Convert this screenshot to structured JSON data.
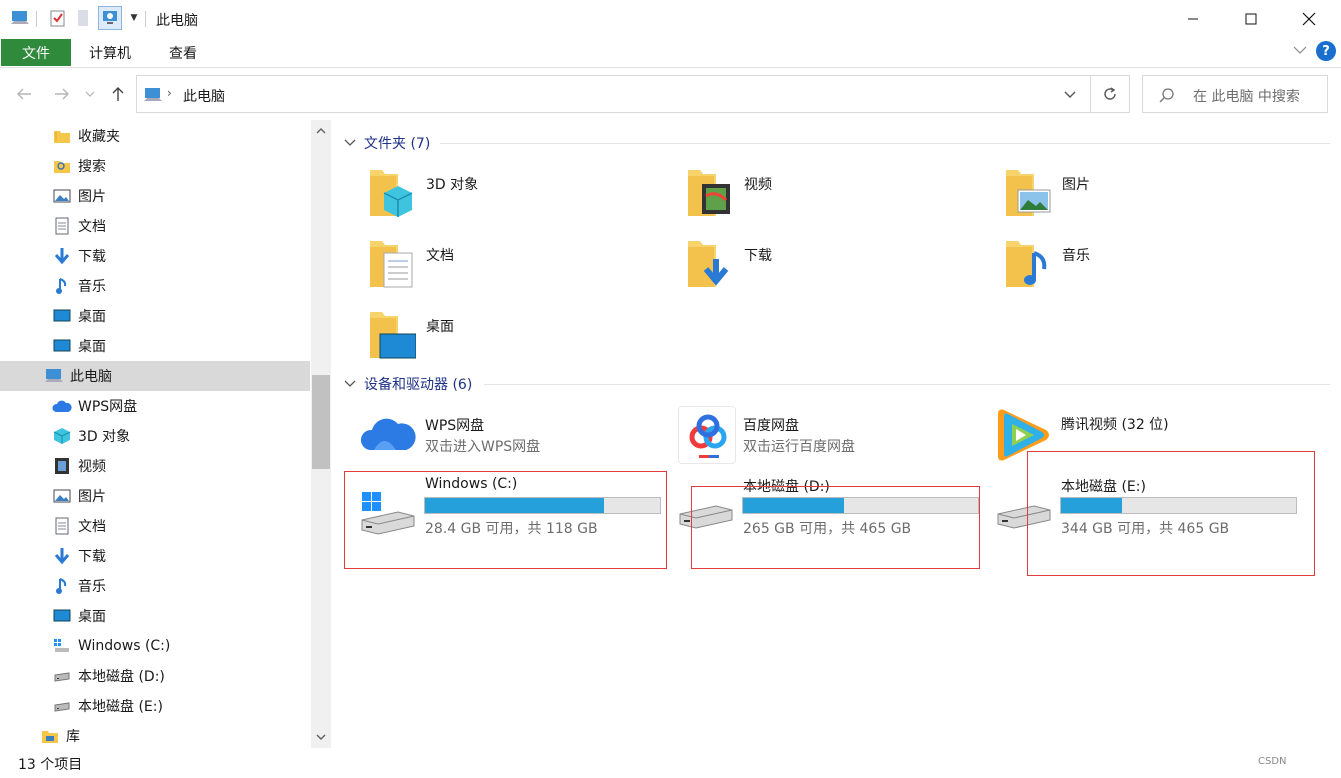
{
  "window": {
    "title": "此电脑"
  },
  "ribbon": {
    "tabs": [
      {
        "label": "文件",
        "active": true
      },
      {
        "label": "计算机",
        "active": false
      },
      {
        "label": "查看",
        "active": false
      }
    ]
  },
  "address": {
    "path": "此电脑",
    "search_placeholder": "在 此电脑 中搜索"
  },
  "sidebar": {
    "items": [
      {
        "label": "收藏夹",
        "icon": "star-folder-icon"
      },
      {
        "label": "搜索",
        "icon": "search-folder-icon"
      },
      {
        "label": "图片",
        "icon": "pictures-icon"
      },
      {
        "label": "文档",
        "icon": "documents-icon"
      },
      {
        "label": "下载",
        "icon": "download-icon"
      },
      {
        "label": "音乐",
        "icon": "music-icon"
      },
      {
        "label": "桌面",
        "icon": "desktop-icon"
      },
      {
        "label": "桌面",
        "icon": "desktop-icon"
      },
      {
        "label": "此电脑",
        "icon": "this-pc-icon",
        "selected": true
      },
      {
        "label": "WPS网盘",
        "icon": "wps-cloud-icon"
      },
      {
        "label": "3D 对象",
        "icon": "3d-objects-icon"
      },
      {
        "label": "视频",
        "icon": "video-icon"
      },
      {
        "label": "图片",
        "icon": "pictures-icon"
      },
      {
        "label": "文档",
        "icon": "documents-icon"
      },
      {
        "label": "下载",
        "icon": "download-icon"
      },
      {
        "label": "音乐",
        "icon": "music-icon"
      },
      {
        "label": "桌面",
        "icon": "desktop-icon"
      },
      {
        "label": "Windows (C:)",
        "icon": "windows-drive-icon"
      },
      {
        "label": "本地磁盘 (D:)",
        "icon": "drive-icon"
      },
      {
        "label": "本地磁盘 (E:)",
        "icon": "drive-icon"
      },
      {
        "label": "库",
        "icon": "library-icon"
      }
    ]
  },
  "folders_group": {
    "header": "文件夹 (7)",
    "items": [
      {
        "label": "3D 对象",
        "icon": "3d-objects-folder-icon"
      },
      {
        "label": "视频",
        "icon": "video-folder-icon"
      },
      {
        "label": "图片",
        "icon": "pictures-folder-icon"
      },
      {
        "label": "文档",
        "icon": "documents-folder-icon"
      },
      {
        "label": "下载",
        "icon": "download-folder-icon"
      },
      {
        "label": "音乐",
        "icon": "music-folder-icon"
      },
      {
        "label": "桌面",
        "icon": "desktop-folder-icon"
      }
    ]
  },
  "devices_group": {
    "header": "设备和驱动器 (6)",
    "apps": [
      {
        "name": "WPS网盘",
        "sub": "双击进入WPS网盘",
        "icon": "wps-cloud-icon"
      },
      {
        "name": "百度网盘",
        "sub": "双击运行百度网盘",
        "icon": "baidu-netdisk-icon"
      },
      {
        "name": "腾讯视频 (32 位)",
        "sub": "",
        "icon": "tencent-video-icon"
      }
    ],
    "drives": [
      {
        "name": "Windows (C:)",
        "sub": "28.4 GB 可用，共 118 GB",
        "used_fraction": 0.76,
        "icon": "windows-drive-icon"
      },
      {
        "name": "本地磁盘 (D:)",
        "sub": "265 GB 可用，共 465 GB",
        "used_fraction": 0.43,
        "icon": "drive-icon"
      },
      {
        "name": "本地磁盘 (E:)",
        "sub": "344 GB 可用，共 465 GB",
        "used_fraction": 0.26,
        "icon": "drive-icon"
      }
    ]
  },
  "status": {
    "count": "13 个项目"
  },
  "colors": {
    "file_tab": "#2f8a3c",
    "group_header": "#1e3287",
    "drive_fill": "#26a0da",
    "highlight_box": "#e03c3c"
  }
}
